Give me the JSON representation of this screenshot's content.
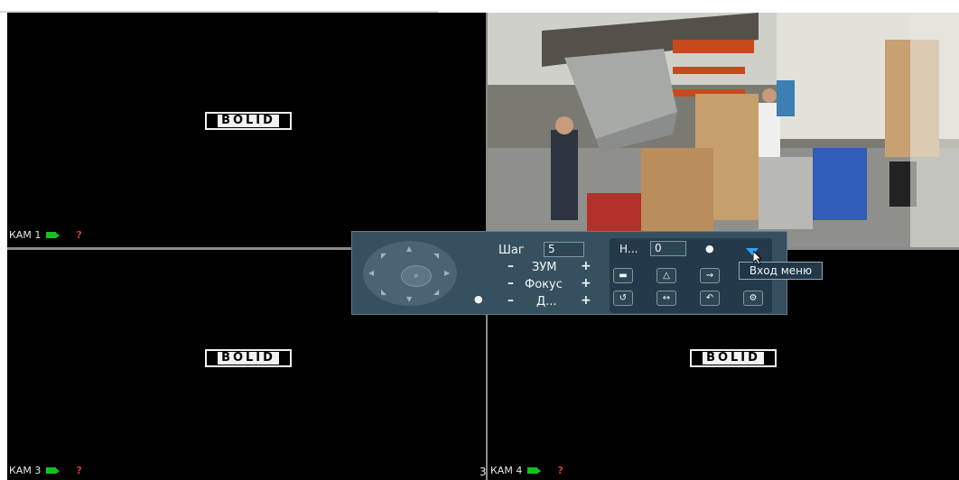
{
  "cells": [
    {
      "label": "КАМ 1",
      "logo": "BOLID",
      "warning": "?"
    },
    {
      "label": "",
      "logo": "",
      "warning": ""
    },
    {
      "label": "КАМ 3",
      "logo": "BOLID",
      "warning": "?"
    },
    {
      "label": "КАМ 4",
      "logo": "BOLID",
      "warning": "?"
    }
  ],
  "channel_number": "3",
  "ptz": {
    "step_label": "Шаг",
    "step_value": "5",
    "zoom_label": "ЗУМ",
    "focus_label": "Фокус",
    "iris_label": "Д...",
    "minus": "–",
    "plus": "+",
    "preset_label": "Н...",
    "preset_value": "0",
    "tooltip": "Вход меню"
  },
  "colors": {
    "panel": "#36505f",
    "cam_icon": "#16c01d",
    "warning": "#e0372d",
    "menu_arrow": "#2aa5ff"
  }
}
